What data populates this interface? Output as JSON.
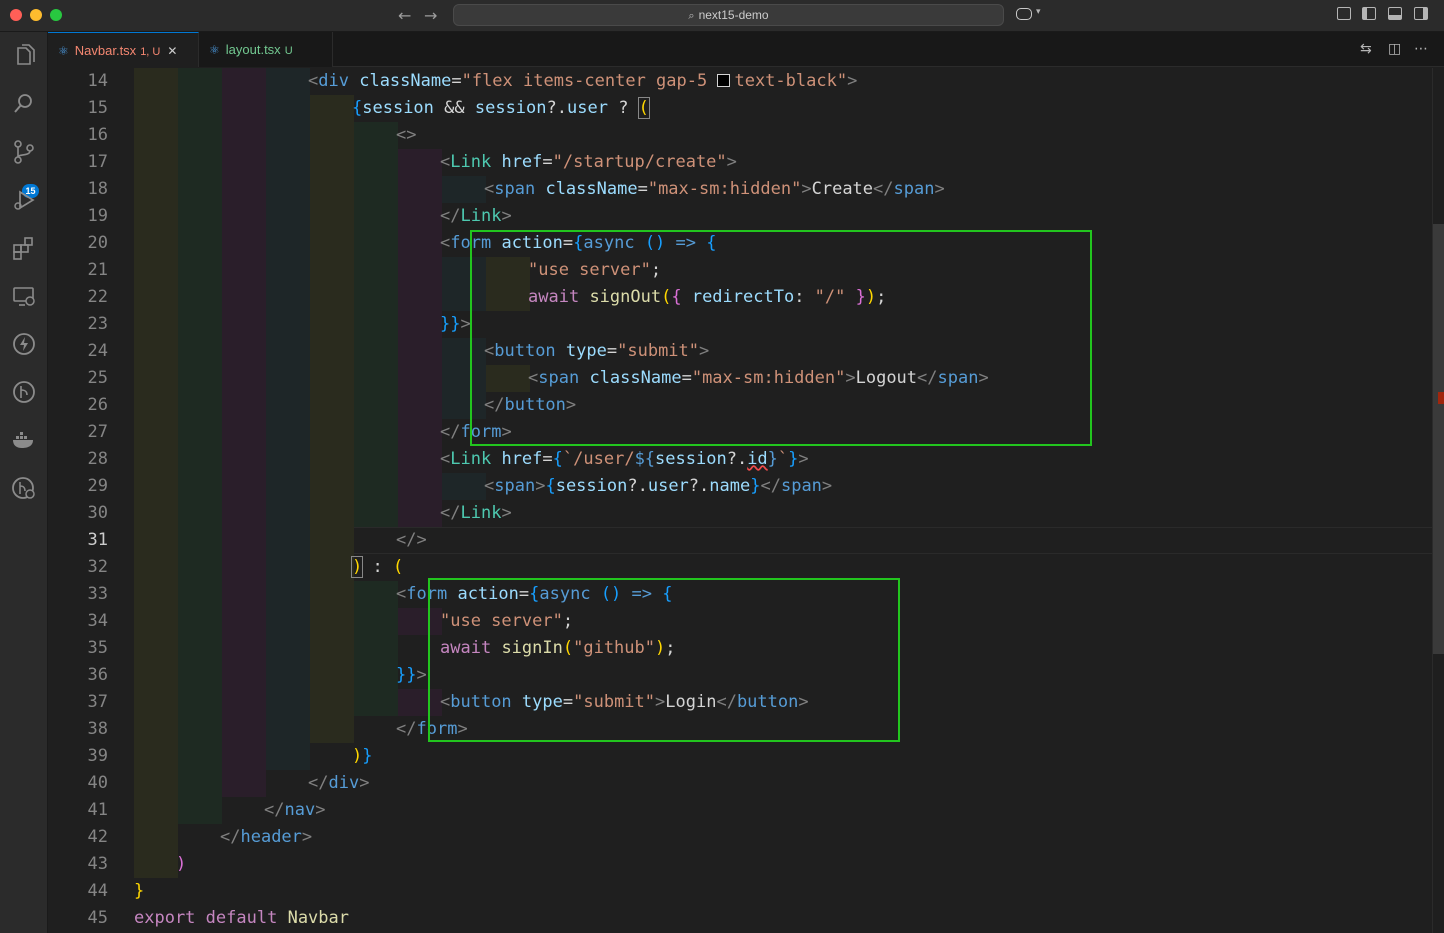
{
  "titlebar": {
    "search_text": "next15-demo",
    "back_icon": "arrow-left-icon",
    "forward_icon": "arrow-right-icon",
    "copilot_icon": "copilot-icon"
  },
  "tabs": [
    {
      "label": "Navbar.tsx",
      "status": "1, U",
      "active": true,
      "color": "#f48771"
    },
    {
      "label": "layout.tsx",
      "status": "U",
      "active": false,
      "color": "#73c991"
    }
  ],
  "activity_bar": {
    "items": [
      "explorer-icon",
      "search-icon",
      "source-control-icon",
      "run-debug-icon",
      "extensions-icon",
      "remote-explorer-icon",
      "thunder-client-icon",
      "gitlens-icon",
      "docker-icon",
      "timeline-icon"
    ],
    "scm_badge": "15"
  },
  "editor": {
    "line_numbers": [
      "14",
      "15",
      "16",
      "17",
      "18",
      "19",
      "20",
      "21",
      "22",
      "23",
      "24",
      "25",
      "26",
      "27",
      "28",
      "29",
      "30",
      "31",
      "32",
      "33",
      "34",
      "35",
      "36",
      "37",
      "38",
      "39",
      "40",
      "41",
      "42",
      "43",
      "44",
      "45"
    ],
    "active_line": "31",
    "lines": {
      "l14": [
        "<",
        "div",
        " ",
        "className",
        "=",
        "\"flex items-center gap-5 ",
        "text-black\"",
        ">"
      ],
      "l15": [
        "{",
        "session",
        " && ",
        "session",
        "?.",
        "user",
        " ? ",
        "("
      ],
      "l16": [
        "<>"
      ],
      "l17": [
        "<",
        "Link",
        " ",
        "href",
        "=",
        "\"/startup/create\"",
        ">"
      ],
      "l18": [
        "<",
        "span",
        " ",
        "className",
        "=",
        "\"max-sm:hidden\"",
        ">",
        "Create",
        "</",
        "span",
        ">"
      ],
      "l19": [
        "</",
        "Link",
        ">"
      ],
      "l20": [
        "<",
        "form",
        " ",
        "action",
        "=",
        "{",
        "async",
        " ",
        "()",
        " => ",
        "{"
      ],
      "l21": [
        "\"use server\"",
        ";"
      ],
      "l22": [
        "await",
        " ",
        "signOut",
        "(",
        "{",
        " redirectTo",
        ": ",
        "\"/\"",
        " ",
        "}",
        ")",
        ";"
      ],
      "l23": [
        "}",
        "}",
        ">"
      ],
      "l24": [
        "<",
        "button",
        " ",
        "type",
        "=",
        "\"submit\"",
        ">"
      ],
      "l25": [
        "<",
        "span",
        " ",
        "className",
        "=",
        "\"max-sm:hidden\"",
        ">",
        "Logout",
        "</",
        "span",
        ">"
      ],
      "l26": [
        "</",
        "button",
        ">"
      ],
      "l27": [
        "</",
        "form",
        ">"
      ],
      "l28": [
        "<",
        "Link",
        " ",
        "href",
        "=",
        "{",
        "`/user/",
        "${",
        "session",
        "?.",
        "id",
        "}",
        "`",
        "}",
        ">"
      ],
      "l29": [
        "<",
        "span",
        ">",
        "{",
        "session",
        "?.",
        "user",
        "?.",
        "name",
        "}",
        "</",
        "span",
        ">"
      ],
      "l30": [
        "</",
        "Link",
        ">"
      ],
      "l31": [
        "</>"
      ],
      "l32": [
        ")",
        " : ",
        "("
      ],
      "l33": [
        "<",
        "form",
        " ",
        "action",
        "=",
        "{",
        "async",
        " ",
        "()",
        " => ",
        "{"
      ],
      "l34": [
        "\"use server\"",
        ";"
      ],
      "l35": [
        "await",
        " ",
        "signIn",
        "(",
        "\"github\"",
        ")",
        ";"
      ],
      "l36": [
        "}",
        "}",
        ">"
      ],
      "l37": [
        "<",
        "button",
        " ",
        "type",
        "=",
        "\"submit\"",
        ">",
        "Login",
        "</",
        "button",
        ">"
      ],
      "l38": [
        "</",
        "form",
        ">"
      ],
      "l39": [
        ")",
        "}"
      ],
      "l40": [
        "</",
        "div",
        ">"
      ],
      "l41": [
        "</",
        "nav",
        ">"
      ],
      "l42": [
        "</",
        "header",
        ">"
      ],
      "l43": [
        ")"
      ],
      "l44": [
        "}"
      ],
      "l45": [
        "export",
        " ",
        "default",
        " ",
        "Navbar"
      ]
    }
  },
  "highlight_boxes": [
    {
      "label": "signout-form-highlight",
      "color": "#22c51e"
    },
    {
      "label": "signin-form-highlight",
      "color": "#22c51e"
    }
  ]
}
